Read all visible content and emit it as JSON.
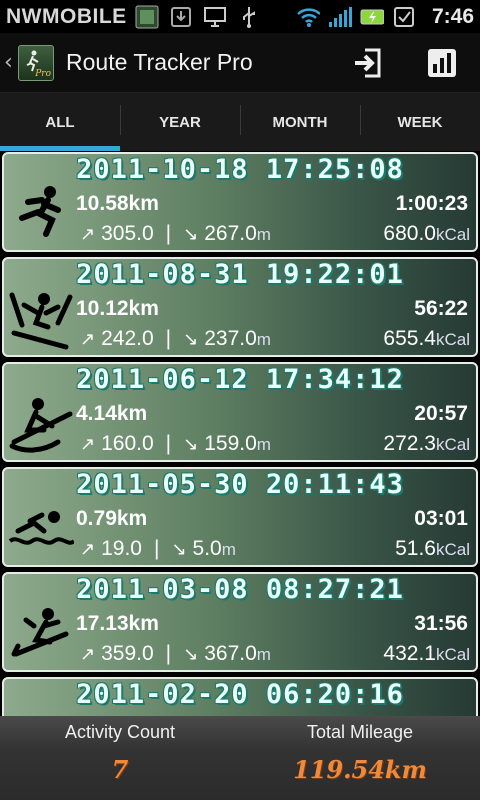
{
  "status_bar": {
    "carrier": "NWMOBILE",
    "time": "7:46",
    "icons": [
      "app-notification-icon",
      "download-icon",
      "monitor-icon",
      "usb-icon",
      "wifi-icon",
      "signal-icon",
      "battery-charging-icon",
      "checkbox-icon"
    ]
  },
  "action_bar": {
    "title": "Route Tracker Pro",
    "app_icon_badge": "Pro",
    "actions": [
      "export-icon",
      "chart-icon"
    ]
  },
  "tabs": [
    {
      "label": "ALL",
      "active": true
    },
    {
      "label": "YEAR",
      "active": false
    },
    {
      "label": "MONTH",
      "active": false
    },
    {
      "label": "WEEK",
      "active": false
    }
  ],
  "activities": [
    {
      "datetime": "2011-10-18 17:25:08",
      "distance": "10.58km",
      "duration": "1:00:23",
      "ascent": "305.0",
      "descent": "267.0",
      "elev_unit": "m",
      "calories": "680.0",
      "cal_unit": "kCal",
      "sport_icon": "running-icon"
    },
    {
      "datetime": "2011-08-31 19:22:01",
      "distance": "10.12km",
      "duration": "56:22",
      "ascent": "242.0",
      "descent": "237.0",
      "elev_unit": "m",
      "calories": "655.4",
      "cal_unit": "kCal",
      "sport_icon": "skiing-icon"
    },
    {
      "datetime": "2011-06-12 17:34:12",
      "distance": "4.14km",
      "duration": "20:57",
      "ascent": "160.0",
      "descent": "159.0",
      "elev_unit": "m",
      "calories": "272.3",
      "cal_unit": "kCal",
      "sport_icon": "rowing-icon"
    },
    {
      "datetime": "2011-05-30 20:11:43",
      "distance": "0.79km",
      "duration": "03:01",
      "ascent": "19.0",
      "descent": "5.0",
      "elev_unit": "m",
      "calories": "51.6",
      "cal_unit": "kCal",
      "sport_icon": "swimming-icon"
    },
    {
      "datetime": "2011-03-08 08:27:21",
      "distance": "17.13km",
      "duration": "31:56",
      "ascent": "359.0",
      "descent": "367.0",
      "elev_unit": "m",
      "calories": "432.1",
      "cal_unit": "kCal",
      "sport_icon": "sledding-icon"
    },
    {
      "datetime": "2011-02-20 06:20:16",
      "distance": "",
      "duration": "",
      "ascent": "",
      "descent": "",
      "elev_unit": "",
      "calories": "",
      "cal_unit": "",
      "sport_icon": "running-icon"
    }
  ],
  "footer": {
    "activity_count_label": "Activity Count",
    "activity_count_value": "7",
    "total_mileage_label": "Total Mileage",
    "total_mileage_value": "119.54km"
  },
  "colors": {
    "tab_indicator": "#35a8d8",
    "footer_value": "#f08a3a",
    "date_shadow": "#1a7a6e"
  }
}
